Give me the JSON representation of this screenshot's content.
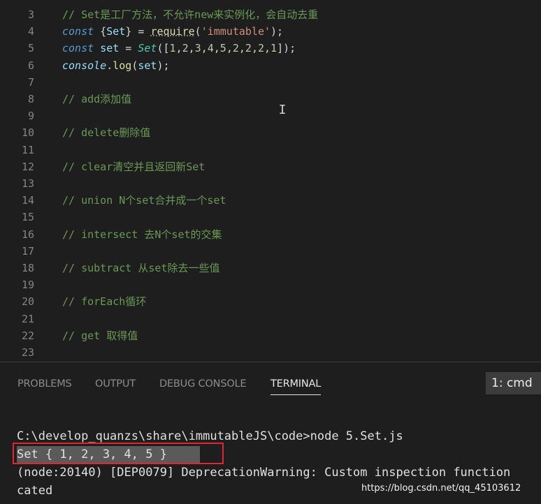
{
  "editor": {
    "lines": [
      {
        "num": "3",
        "segs": [
          {
            "c": "cm",
            "t": "// Set是工厂方法，不允许new来实例化，会自动去重"
          }
        ]
      },
      {
        "num": "4",
        "segs": [
          {
            "c": "kw",
            "t": "const"
          },
          {
            "c": "op",
            "t": " {"
          },
          {
            "c": "var",
            "t": "Set"
          },
          {
            "c": "op",
            "t": "} = "
          },
          {
            "c": "fn req",
            "t": "require"
          },
          {
            "c": "op",
            "t": "("
          },
          {
            "c": "str",
            "t": "'immutable'"
          },
          {
            "c": "op",
            "t": ");"
          }
        ]
      },
      {
        "num": "5",
        "segs": [
          {
            "c": "kw",
            "t": "const"
          },
          {
            "c": "op",
            "t": " "
          },
          {
            "c": "var",
            "t": "set"
          },
          {
            "c": "op",
            "t": " = "
          },
          {
            "c": "cls",
            "t": "Set"
          },
          {
            "c": "op",
            "t": "(["
          },
          {
            "c": "num",
            "t": "1"
          },
          {
            "c": "op",
            "t": ","
          },
          {
            "c": "num",
            "t": "2"
          },
          {
            "c": "op",
            "t": ","
          },
          {
            "c": "num",
            "t": "3"
          },
          {
            "c": "op",
            "t": ","
          },
          {
            "c": "num",
            "t": "4"
          },
          {
            "c": "op",
            "t": ","
          },
          {
            "c": "num",
            "t": "5"
          },
          {
            "c": "op",
            "t": ","
          },
          {
            "c": "num",
            "t": "2"
          },
          {
            "c": "op",
            "t": ","
          },
          {
            "c": "num",
            "t": "2"
          },
          {
            "c": "op",
            "t": ","
          },
          {
            "c": "num",
            "t": "2"
          },
          {
            "c": "op",
            "t": ","
          },
          {
            "c": "num",
            "t": "1"
          },
          {
            "c": "op",
            "t": "]);"
          }
        ]
      },
      {
        "num": "6",
        "segs": [
          {
            "c": "var kw",
            "t": "console"
          },
          {
            "c": "op",
            "t": "."
          },
          {
            "c": "fn",
            "t": "log"
          },
          {
            "c": "op",
            "t": "("
          },
          {
            "c": "var",
            "t": "set"
          },
          {
            "c": "op",
            "t": ");"
          }
        ]
      },
      {
        "num": "7",
        "segs": []
      },
      {
        "num": "8",
        "segs": [
          {
            "c": "cm",
            "t": "// add添加值"
          }
        ]
      },
      {
        "num": "9",
        "segs": []
      },
      {
        "num": "10",
        "segs": [
          {
            "c": "cm",
            "t": "// delete删除值"
          }
        ]
      },
      {
        "num": "11",
        "segs": []
      },
      {
        "num": "12",
        "segs": [
          {
            "c": "cm",
            "t": "// clear清空并且返回新Set"
          }
        ]
      },
      {
        "num": "13",
        "segs": []
      },
      {
        "num": "14",
        "segs": [
          {
            "c": "cm",
            "t": "// union N个set合并成一个set"
          }
        ]
      },
      {
        "num": "15",
        "segs": []
      },
      {
        "num": "16",
        "segs": [
          {
            "c": "cm",
            "t": "// intersect 去N个set的交集"
          }
        ]
      },
      {
        "num": "17",
        "segs": []
      },
      {
        "num": "18",
        "segs": [
          {
            "c": "cm",
            "t": "// subtract 从set除去一些值"
          }
        ]
      },
      {
        "num": "19",
        "segs": []
      },
      {
        "num": "20",
        "segs": [
          {
            "c": "cm",
            "t": "// forEach循环"
          }
        ]
      },
      {
        "num": "21",
        "segs": []
      },
      {
        "num": "22",
        "segs": [
          {
            "c": "cm",
            "t": "// get 取得值"
          }
        ]
      },
      {
        "num": "23",
        "segs": []
      }
    ]
  },
  "panel": {
    "tabs": [
      {
        "id": "problems",
        "label": "PROBLEMS"
      },
      {
        "id": "output",
        "label": "OUTPUT"
      },
      {
        "id": "debug-console",
        "label": "DEBUG CONSOLE"
      },
      {
        "id": "terminal",
        "label": "TERMINAL"
      }
    ],
    "active_tab": "TERMINAL",
    "terminal_select": "1: cmd"
  },
  "terminal": {
    "lines": [
      "C:\\develop_quanzs\\share\\immutableJS\\code>node 5.Set.js",
      "Set { 1, 2, 3, 4, 5 }",
      "(node:20140) [DEP0079] DeprecationWarning: Custom inspection function",
      "cated"
    ]
  },
  "watermark": "https://blog.csdn.net/qq_45103612",
  "colors": {
    "background": "#1e1e1e",
    "comment": "#6a9955",
    "keyword": "#569cd6",
    "string": "#ce9178",
    "number": "#b5cea8",
    "highlight_box": "#e0262f"
  }
}
